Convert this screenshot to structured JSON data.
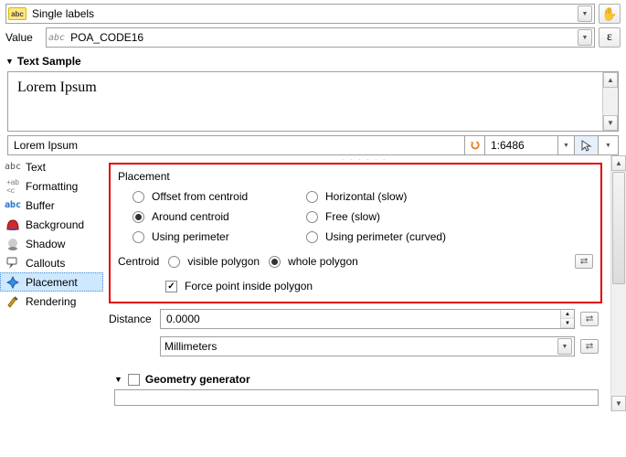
{
  "mode": {
    "selected_label": "Single labels"
  },
  "value": {
    "label": "Value",
    "field_prefix": "abc",
    "field_name": "POA_CODE16"
  },
  "text_sample": {
    "heading": "Text Sample",
    "preview_text": "Lorem Ipsum",
    "input_value": "Lorem Ipsum",
    "scale_value": "1:6486"
  },
  "sidebar": {
    "items": [
      {
        "label": "Text"
      },
      {
        "label": "Formatting"
      },
      {
        "label": "Buffer"
      },
      {
        "label": "Background"
      },
      {
        "label": "Shadow"
      },
      {
        "label": "Callouts"
      },
      {
        "label": "Placement"
      },
      {
        "label": "Rendering"
      }
    ]
  },
  "placement": {
    "title": "Placement",
    "options": {
      "offset_centroid": "Offset from centroid",
      "horizontal": "Horizontal (slow)",
      "around_centroid": "Around centroid",
      "free": "Free (slow)",
      "using_perimeter": "Using perimeter",
      "using_perimeter_curved": "Using perimeter (curved)"
    },
    "selected": "around_centroid",
    "centroid": {
      "label": "Centroid",
      "visible_polygon": "visible polygon",
      "whole_polygon": "whole polygon",
      "selected": "whole_polygon"
    },
    "force_inside_label": "Force point inside polygon",
    "force_inside_checked": true
  },
  "distance": {
    "label": "Distance",
    "value": "0.0000",
    "unit": "Millimeters"
  },
  "geometry_generator": {
    "label": "Geometry generator"
  }
}
